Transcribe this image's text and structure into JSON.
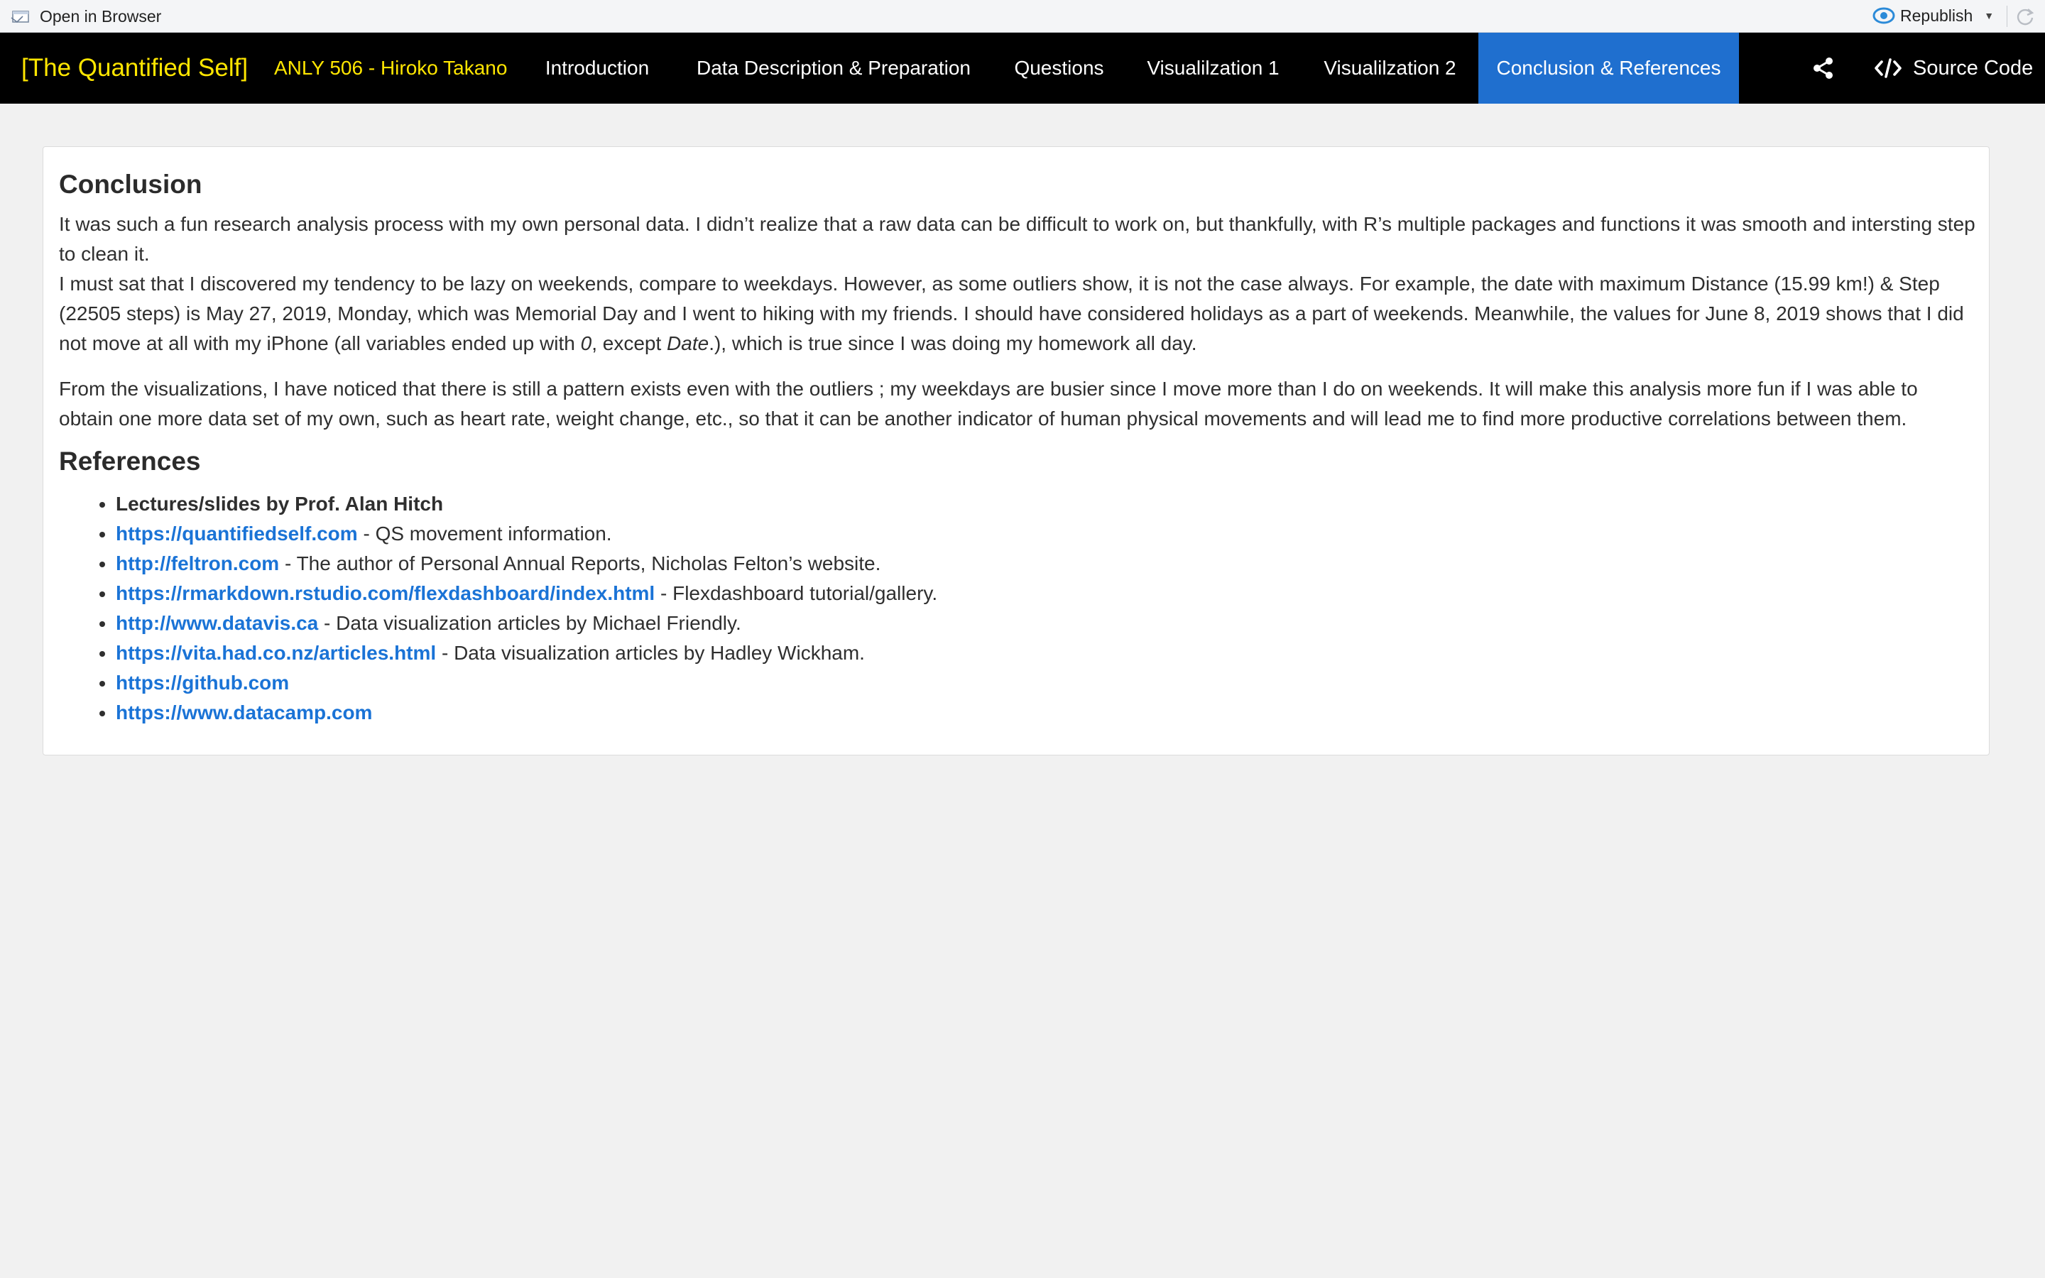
{
  "viewer": {
    "open_in_browser": "Open in Browser",
    "republish": "Republish"
  },
  "navbar": {
    "brand": "[The Quantified Self]",
    "author": "ANLY 506 - Hiroko Takano",
    "items": [
      {
        "label": "Introduction"
      },
      {
        "label": "Data Description & Preparation"
      },
      {
        "label": "Questions"
      },
      {
        "label": "Visualilzation 1"
      },
      {
        "label": "Visualilzation 2"
      },
      {
        "label": "Conclusion & References"
      }
    ],
    "active_index": 5,
    "source_code": "Source Code",
    "colors": {
      "background": "#000000",
      "brand": "#ffe600",
      "active": "#1f6fcf"
    }
  },
  "conclusion": {
    "title": "Conclusion",
    "p1": "It was such a fun research analysis process with my own personal data. I didn’t realize that a raw data can be difficult to work on, but thankfully, with R’s multiple packages and functions it was smooth and intersting step to clean it.",
    "p2_a": "I must sat that I discovered my tendency to be lazy on weekends, compare to weekdays. However, as some outliers show, it is not the case always. For example, the date with maximum Distance (15.99 km!) & Step (22505 steps) is May 27, 2019, Monday, which was Memorial Day and I went to hiking with my friends. I should have considered holidays as a part of weekends. Meanwhile, the values for June 8, 2019 shows that I did not move at all with my iPhone (all variables ended up with ",
    "p2_zero": "0",
    "p2_b": ", except ",
    "p2_date": "Date",
    "p2_c": ".), which is true since I was doing my homework all day.",
    "p3": "From the visualizations, I have noticed that there is still a pattern exists even with the outliers ; my weekdays are busier since I move more than I do on weekends. It will make this analysis more fun if I was able to obtain one more data set of my own, such as heart rate, weight change, etc., so that it can be another indicator of human physical movements and will lead me to find more productive correlations between them."
  },
  "references": {
    "title": "References",
    "first": "Lectures/slides by Prof. Alan Hitch",
    "items": [
      {
        "link": "https://quantifiedself.com",
        "desc": " - QS movement information."
      },
      {
        "link": "http://feltron.com",
        "desc": " - The author of Personal Annual Reports, Nicholas Felton’s website."
      },
      {
        "link": "https://rmarkdown.rstudio.com/flexdashboard/index.html",
        "desc": " - Flexdashboard tutorial/gallery."
      },
      {
        "link": "http://www.datavis.ca",
        "desc": " - Data visualization articles by Michael Friendly."
      },
      {
        "link": "https://vita.had.co.nz/articles.html",
        "desc": " - Data visualization articles by Hadley Wickham."
      },
      {
        "link": "https://github.com",
        "desc": ""
      },
      {
        "link": "https://www.datacamp.com",
        "desc": ""
      }
    ]
  }
}
